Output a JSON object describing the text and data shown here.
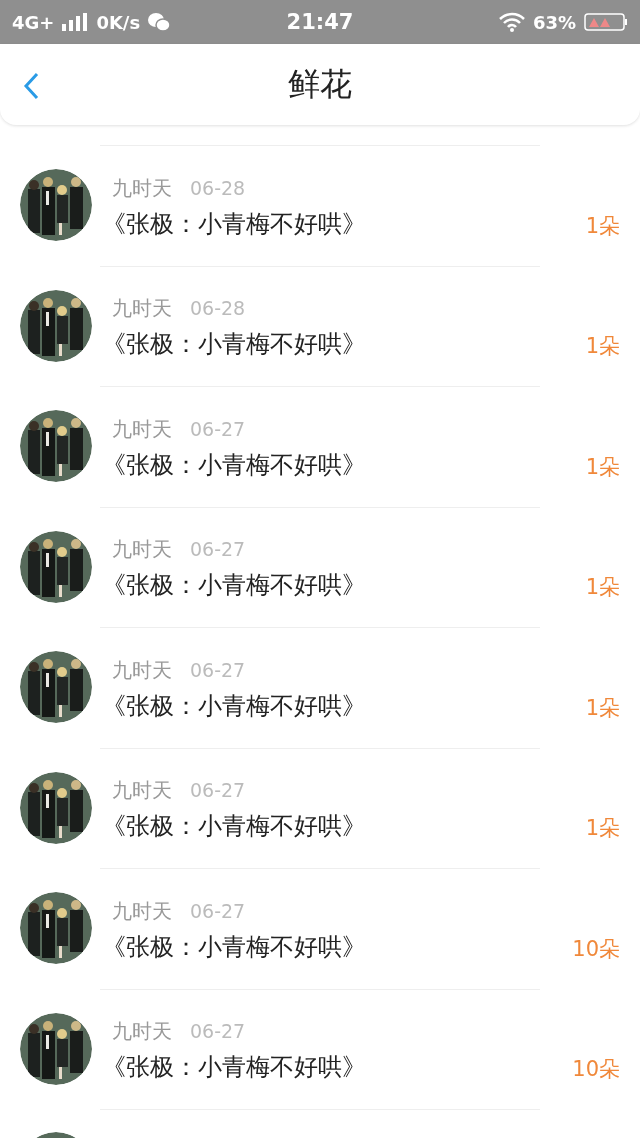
{
  "status_bar": {
    "network": "4G+",
    "speed": "0K/s",
    "time": "21:47",
    "battery": "63%"
  },
  "header": {
    "title": "鲜花"
  },
  "rows": [
    {
      "name": "九时天",
      "date": "06-28",
      "title": "《张极：小青梅不好哄》",
      "amount": "1朵"
    },
    {
      "name": "九时天",
      "date": "06-28",
      "title": "《张极：小青梅不好哄》",
      "amount": "1朵"
    },
    {
      "name": "九时天",
      "date": "06-27",
      "title": "《张极：小青梅不好哄》",
      "amount": "1朵"
    },
    {
      "name": "九时天",
      "date": "06-27",
      "title": "《张极：小青梅不好哄》",
      "amount": "1朵"
    },
    {
      "name": "九时天",
      "date": "06-27",
      "title": "《张极：小青梅不好哄》",
      "amount": "1朵"
    },
    {
      "name": "九时天",
      "date": "06-27",
      "title": "《张极：小青梅不好哄》",
      "amount": "1朵"
    },
    {
      "name": "九时天",
      "date": "06-27",
      "title": "《张极：小青梅不好哄》",
      "amount": "10朵"
    },
    {
      "name": "九时天",
      "date": "06-27",
      "title": "《张极：小青梅不好哄》",
      "amount": "10朵"
    }
  ]
}
